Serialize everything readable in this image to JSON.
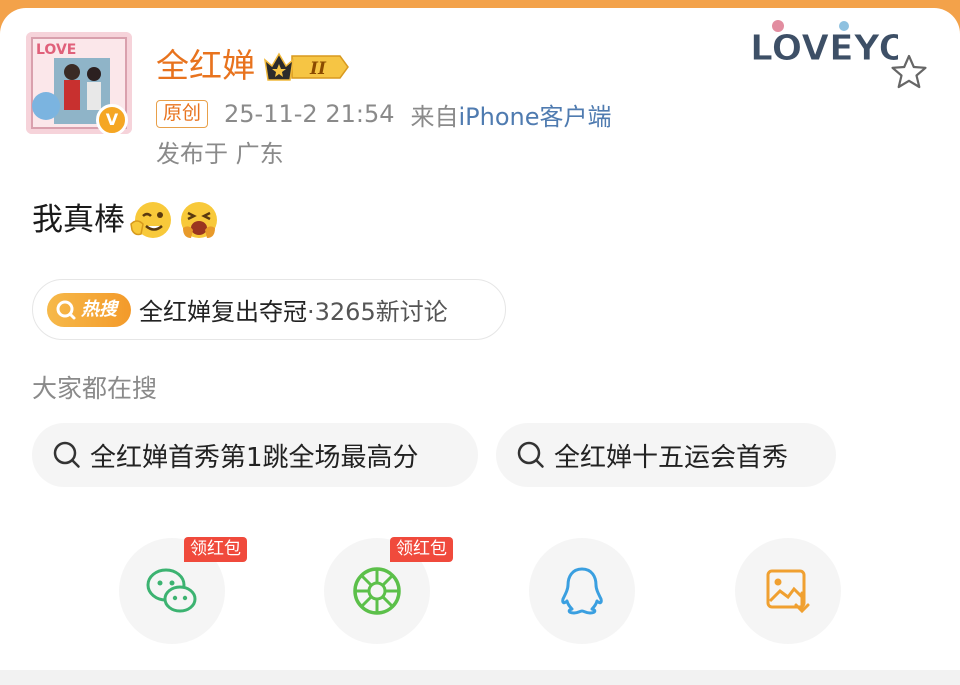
{
  "post": {
    "username": "全红婵",
    "level_badge": "II",
    "original_label": "原创",
    "timestamp": "25-11-2 21:54",
    "source_prefix": "来自",
    "source_device": "iPhone客户端",
    "location": "发布于 广东",
    "text": "我真棒"
  },
  "hot_search": {
    "tag": "热搜",
    "topic": "全红婵复出夺冠",
    "count": "·3265新讨论"
  },
  "related": {
    "title": "大家都在搜",
    "items": [
      {
        "label": "全红婵首秀第1跳全场最高分"
      },
      {
        "label": "全红婵十五运会首秀"
      }
    ]
  },
  "share": {
    "redpack_label": "领红包",
    "buttons": [
      {
        "icon": "wechat-icon"
      },
      {
        "icon": "moments-icon"
      },
      {
        "icon": "qq-icon"
      },
      {
        "icon": "save-image-icon"
      }
    ]
  },
  "watermark": "LOVEYOU",
  "colors": {
    "accent": "#e8731e",
    "link": "#4f7bb0",
    "redpack": "#f04a3c"
  }
}
